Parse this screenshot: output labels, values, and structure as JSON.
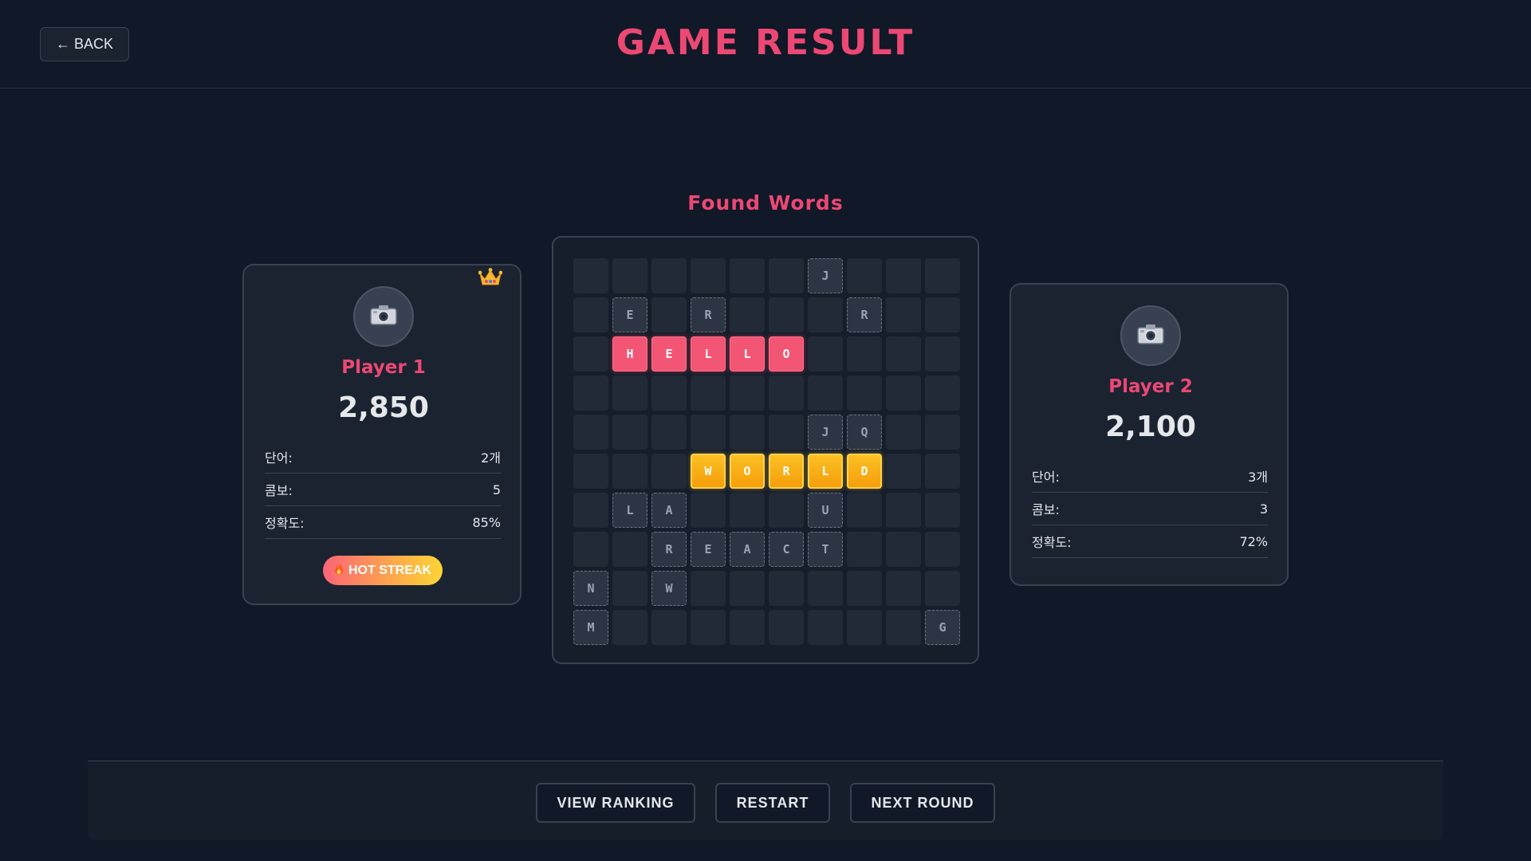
{
  "header": {
    "back_label": "← BACK",
    "title": "GAME RESULT"
  },
  "found_words_title": "Found Words",
  "players": [
    {
      "name": "Player 1",
      "score": "2,850",
      "winner": true,
      "avatar_icon": "camera-icon",
      "stats": [
        {
          "label": "단어:",
          "value": "2개"
        },
        {
          "label": "콤보:",
          "value": "5"
        },
        {
          "label": "정확도:",
          "value": "85%"
        }
      ],
      "badge": {
        "icon": "fire-icon",
        "label": "HOT STREAK"
      }
    },
    {
      "name": "Player 2",
      "score": "2,100",
      "winner": false,
      "avatar_icon": "camera-icon",
      "stats": [
        {
          "label": "단어:",
          "value": "3개"
        },
        {
          "label": "콤보:",
          "value": "3"
        },
        {
          "label": "정확도:",
          "value": "72%"
        }
      ]
    }
  ],
  "board": {
    "rows": [
      [
        ".",
        ".",
        ".",
        ".",
        ".",
        ".",
        "J",
        ".",
        ".",
        "."
      ],
      [
        ".",
        "E",
        ".",
        "R",
        ".",
        ".",
        ".",
        "R",
        ".",
        "."
      ],
      [
        ".",
        "H",
        "E",
        "L",
        "L",
        "O",
        ".",
        ".",
        ".",
        "."
      ],
      [
        ".",
        ".",
        ".",
        ".",
        ".",
        ".",
        ".",
        ".",
        ".",
        "."
      ],
      [
        ".",
        ".",
        ".",
        ".",
        ".",
        ".",
        "J",
        "Q",
        ".",
        "."
      ],
      [
        ".",
        ".",
        ".",
        "W",
        "O",
        "R",
        "L",
        "D",
        ".",
        "."
      ],
      [
        ".",
        "L",
        "A",
        ".",
        ".",
        ".",
        "U",
        ".",
        ".",
        "."
      ],
      [
        ".",
        ".",
        "R",
        "E",
        "A",
        "C",
        "T",
        ".",
        ".",
        "."
      ],
      [
        "N",
        ".",
        "W",
        ".",
        ".",
        ".",
        ".",
        ".",
        ".",
        "."
      ],
      [
        "M",
        ".",
        ".",
        ".",
        ".",
        ".",
        ".",
        ".",
        ".",
        "G"
      ]
    ],
    "highlights": [
      {
        "word": "HELLO",
        "color": "#f35575",
        "style": "pink",
        "row": 2,
        "cols": [
          1,
          2,
          3,
          4,
          5
        ]
      },
      {
        "word": "WORLD",
        "color": "#fbbf24",
        "style": "gold",
        "row": 5,
        "cols": [
          3,
          4,
          5,
          6,
          7
        ]
      }
    ]
  },
  "footer": {
    "view_ranking_label": "VIEW RANKING",
    "restart_label": "RESTART",
    "next_round_label": "NEXT ROUND"
  },
  "colors": {
    "accent": "#ec4874",
    "background": "#111827",
    "card": "#1b2331"
  }
}
